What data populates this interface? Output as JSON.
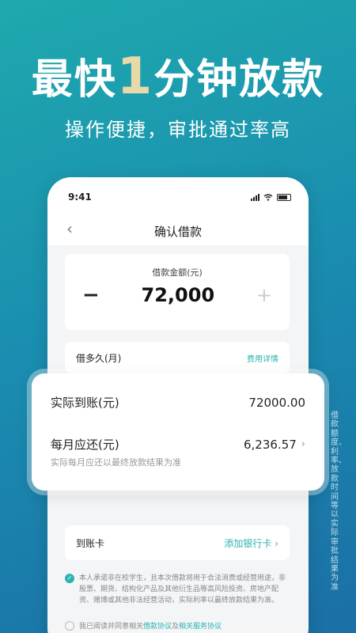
{
  "promo": {
    "headline_prefix": "最快",
    "headline_number": "1",
    "headline_suffix": "分钟放款",
    "subtitle": "操作便捷，审批通过率高"
  },
  "status_bar": {
    "time": "9:41"
  },
  "nav": {
    "back_icon": "chevron-left-icon",
    "title": "确认借款"
  },
  "amount": {
    "label": "借款金额(元)",
    "minus": "−",
    "value": "72,000",
    "plus": "+"
  },
  "term": {
    "label": "借多久(月)",
    "link": "费用详情"
  },
  "summary": {
    "received_label": "实际到账(元)",
    "received_value": "72000.00",
    "monthly_label": "每月应还(元)",
    "monthly_value": "6,236.57",
    "note": "实际每月应还以最终放款结果为准"
  },
  "bank": {
    "label": "到账卡",
    "link": "添加银行卡 ›"
  },
  "notice": {
    "text": "本人承诺非在校学生，且本次借款将用于合法消费或经营用途，非股票、期货、结构化产品及其他衍生品等高风险投资、房地产配资、赌博或其他非法经营活动，实际利率以最终放款结果为准。"
  },
  "agreement": {
    "prefix": "我已阅读并同意相关",
    "link1": "借款协议",
    "join": "及",
    "link2": "相关服务协议"
  },
  "side_note": "借款额度、利率、放款时间等以实际审批结果为准",
  "colors": {
    "accent": "#2bb3b0",
    "bg_start": "#1fa9ad",
    "bg_end": "#1b6fa6"
  }
}
